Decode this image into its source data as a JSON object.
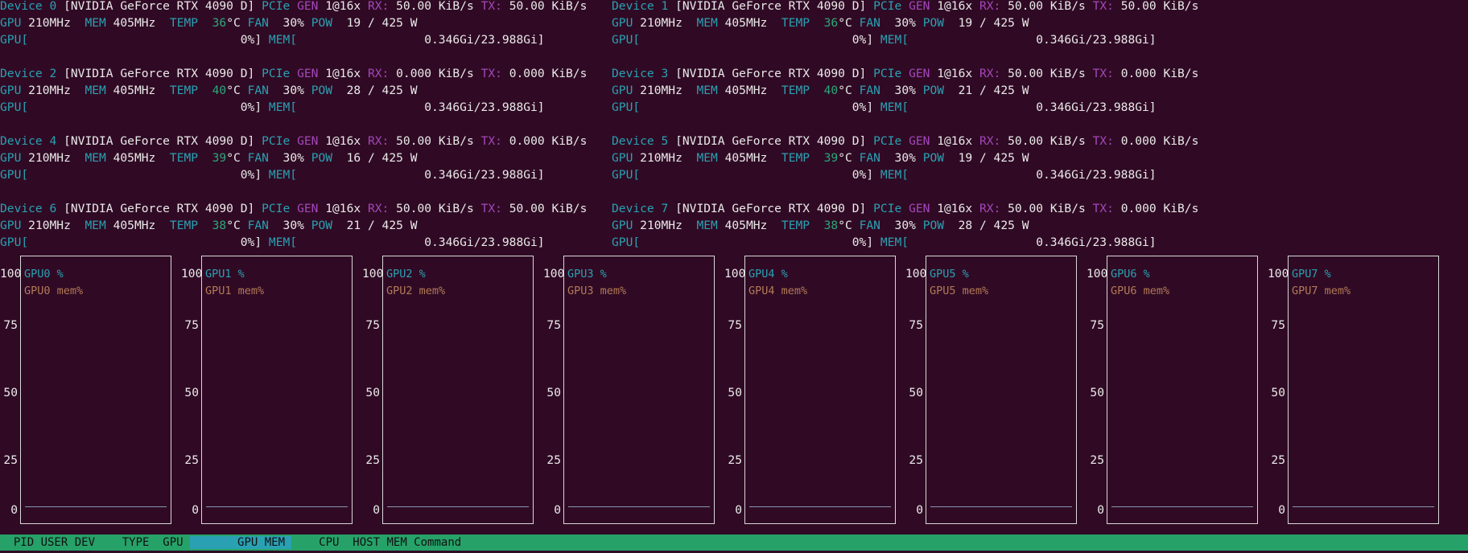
{
  "devices": [
    {
      "id": "Device 0",
      "name": "[NVIDIA GeForce RTX 4090 D]",
      "gen": "1@16x",
      "rx": "50.00 KiB/s",
      "tx": "50.00 KiB/s",
      "gpu_clk": "210MHz",
      "mem_clk": "405MHz",
      "temp": "36",
      "fan": "30%",
      "pow": "19 / 425 W",
      "gpu_util": "0%]",
      "mem_use": "0.346Gi/23.988Gi]"
    },
    {
      "id": "Device 1",
      "name": "[NVIDIA GeForce RTX 4090 D]",
      "gen": "1@16x",
      "rx": "50.00 KiB/s",
      "tx": "50.00 KiB/s",
      "gpu_clk": "210MHz",
      "mem_clk": "405MHz",
      "temp": "36",
      "fan": "30%",
      "pow": "19 / 425 W",
      "gpu_util": "0%]",
      "mem_use": "0.346Gi/23.988Gi]"
    },
    {
      "id": "Device 2",
      "name": "[NVIDIA GeForce RTX 4090 D]",
      "gen": "1@16x",
      "rx": "0.000 KiB/s",
      "tx": "0.000 KiB/s",
      "gpu_clk": "210MHz",
      "mem_clk": "405MHz",
      "temp": "40",
      "fan": "30%",
      "pow": "28 / 425 W",
      "gpu_util": "0%]",
      "mem_use": "0.346Gi/23.988Gi]"
    },
    {
      "id": "Device 3",
      "name": "[NVIDIA GeForce RTX 4090 D]",
      "gen": "1@16x",
      "rx": "50.00 KiB/s",
      "tx": "0.000 KiB/s",
      "gpu_clk": "210MHz",
      "mem_clk": "405MHz",
      "temp": "40",
      "fan": "30%",
      "pow": "21 / 425 W",
      "gpu_util": "0%]",
      "mem_use": "0.346Gi/23.988Gi]"
    },
    {
      "id": "Device 4",
      "name": "[NVIDIA GeForce RTX 4090 D]",
      "gen": "1@16x",
      "rx": "50.00 KiB/s",
      "tx": "0.000 KiB/s",
      "gpu_clk": "210MHz",
      "mem_clk": "405MHz",
      "temp": "39",
      "fan": "30%",
      "pow": "16 / 425 W",
      "gpu_util": "0%]",
      "mem_use": "0.346Gi/23.988Gi]"
    },
    {
      "id": "Device 5",
      "name": "[NVIDIA GeForce RTX 4090 D]",
      "gen": "1@16x",
      "rx": "50.00 KiB/s",
      "tx": "0.000 KiB/s",
      "gpu_clk": "210MHz",
      "mem_clk": "405MHz",
      "temp": "39",
      "fan": "30%",
      "pow": "19 / 425 W",
      "gpu_util": "0%]",
      "mem_use": "0.346Gi/23.988Gi]"
    },
    {
      "id": "Device 6",
      "name": "[NVIDIA GeForce RTX 4090 D]",
      "gen": "1@16x",
      "rx": "50.00 KiB/s",
      "tx": "50.00 KiB/s",
      "gpu_clk": "210MHz",
      "mem_clk": "405MHz",
      "temp": "38",
      "fan": "30%",
      "pow": "21 / 425 W",
      "gpu_util": "0%]",
      "mem_use": "0.346Gi/23.988Gi]"
    },
    {
      "id": "Device 7",
      "name": "[NVIDIA GeForce RTX 4090 D]",
      "gen": "1@16x",
      "rx": "50.00 KiB/s",
      "tx": "0.000 KiB/s",
      "gpu_clk": "210MHz",
      "mem_clk": "405MHz",
      "temp": "38",
      "fan": "30%",
      "pow": "28 / 425 W",
      "gpu_util": "0%]",
      "mem_use": "0.346Gi/23.988Gi]"
    }
  ],
  "labels": {
    "pcie": "PCIe",
    "gen": "GEN",
    "rx": "RX:",
    "tx": "TX:",
    "gpu": "GPU",
    "mem": "MEM",
    "temp": "TEMP",
    "fan": "FAN",
    "pow": "POW",
    "deg": "°C",
    "gpu_bar": "GPU[",
    "mem_bar": "MEM["
  },
  "charts": [
    {
      "util_label": "GPU0 %",
      "mem_label": "GPU0 mem%"
    },
    {
      "util_label": "GPU1 %",
      "mem_label": "GPU1 mem%"
    },
    {
      "util_label": "GPU2 %",
      "mem_label": "GPU2 mem%"
    },
    {
      "util_label": "GPU3 %",
      "mem_label": "GPU3 mem%"
    },
    {
      "util_label": "GPU4 %",
      "mem_label": "GPU4 mem%"
    },
    {
      "util_label": "GPU5 %",
      "mem_label": "GPU5 mem%"
    },
    {
      "util_label": "GPU6 %",
      "mem_label": "GPU6 mem%"
    },
    {
      "util_label": "GPU7 %",
      "mem_label": "GPU7 mem%"
    }
  ],
  "y_ticks": [
    "100",
    "75",
    "50",
    "25",
    "0"
  ],
  "footer": {
    "pre": "  PID USER DEV    TYPE  GPU ",
    "sorted": "       GPU MEM ",
    "post": "    CPU  HOST MEM Command"
  },
  "colors": {
    "background": "#300a24",
    "cyan": "#2aa1b3",
    "magenta": "#a347ba",
    "green": "#2aa87a",
    "mem_legend": "#b27a57",
    "footer": "#26a269"
  }
}
